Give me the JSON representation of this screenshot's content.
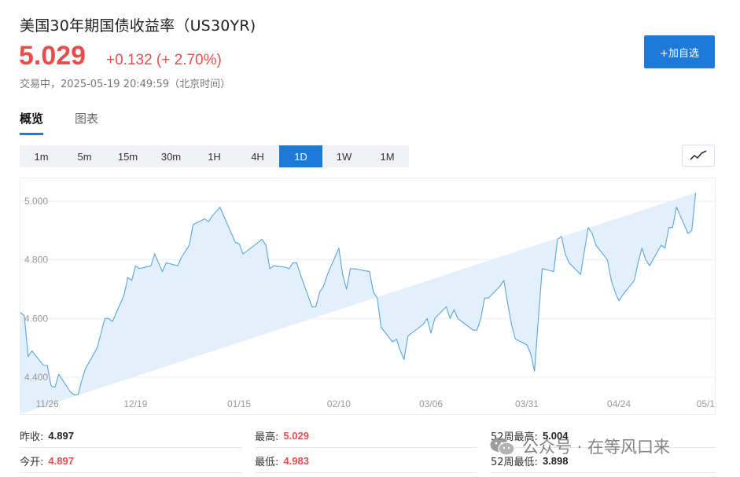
{
  "header": {
    "title": "美国30年期国债收益率（US30YR)",
    "price": "5.029",
    "change": "+0.132 (+ 2.70%)",
    "status": "交易中，2025-05-19 20:49:59（北京时间）",
    "fav_button": "+加自选"
  },
  "tabs": [
    {
      "label": "概览",
      "active": true
    },
    {
      "label": "图表",
      "active": false
    }
  ],
  "periods": [
    {
      "label": "1m",
      "active": false
    },
    {
      "label": "5m",
      "active": false
    },
    {
      "label": "15m",
      "active": false
    },
    {
      "label": "30m",
      "active": false
    },
    {
      "label": "1H",
      "active": false
    },
    {
      "label": "4H",
      "active": false
    },
    {
      "label": "1D",
      "active": true
    },
    {
      "label": "1W",
      "active": false
    },
    {
      "label": "1M",
      "active": false
    }
  ],
  "chart_type_icon": "line-chart-icon",
  "chart_data": {
    "type": "area",
    "x": [
      "2024-11-19",
      "2024-11-20",
      "2024-11-21",
      "2024-11-22",
      "2024-11-25",
      "2024-11-26",
      "2024-11-27",
      "2024-11-28",
      "2024-11-29",
      "2024-12-02",
      "2024-12-03",
      "2024-12-04",
      "2024-12-05",
      "2024-12-06",
      "2024-12-09",
      "2024-12-10",
      "2024-12-11",
      "2024-12-12",
      "2024-12-13",
      "2024-12-16",
      "2024-12-17",
      "2024-12-18",
      "2024-12-19",
      "2024-12-20",
      "2024-12-23",
      "2024-12-24",
      "2024-12-26",
      "2024-12-27",
      "2024-12-30",
      "2024-12-31",
      "2025-01-02",
      "2025-01-03",
      "2025-01-06",
      "2025-01-07",
      "2025-01-08",
      "2025-01-09",
      "2025-01-10",
      "2025-01-13",
      "2025-01-14",
      "2025-01-15",
      "2025-01-16",
      "2025-01-17",
      "2025-01-21",
      "2025-01-22",
      "2025-01-23",
      "2025-01-24",
      "2025-01-27",
      "2025-01-28",
      "2025-01-29",
      "2025-01-30",
      "2025-01-31",
      "2025-02-03",
      "2025-02-04",
      "2025-02-05",
      "2025-02-06",
      "2025-02-07",
      "2025-02-10",
      "2025-02-11",
      "2025-02-12",
      "2025-02-13",
      "2025-02-14",
      "2025-02-18",
      "2025-02-19",
      "2025-02-20",
      "2025-02-21",
      "2025-02-24",
      "2025-02-25",
      "2025-02-26",
      "2025-02-27",
      "2025-02-28",
      "2025-03-03",
      "2025-03-04",
      "2025-03-05",
      "2025-03-06",
      "2025-03-07",
      "2025-03-10",
      "2025-03-11",
      "2025-03-12",
      "2025-03-13",
      "2025-03-14",
      "2025-03-17",
      "2025-03-18",
      "2025-03-19",
      "2025-03-20",
      "2025-03-21",
      "2025-03-24",
      "2025-03-25",
      "2025-03-26",
      "2025-03-27",
      "2025-03-28",
      "2025-03-31",
      "2025-04-01",
      "2025-04-02",
      "2025-04-03",
      "2025-04-04",
      "2025-04-07",
      "2025-04-08",
      "2025-04-09",
      "2025-04-10",
      "2025-04-11",
      "2025-04-14",
      "2025-04-15",
      "2025-04-16",
      "2025-04-17",
      "2025-04-18",
      "2025-04-21",
      "2025-04-22",
      "2025-04-23",
      "2025-04-24",
      "2025-04-25",
      "2025-04-28",
      "2025-04-29",
      "2025-04-30",
      "2025-05-01",
      "2025-05-02",
      "2025-05-05",
      "2025-05-06",
      "2025-05-07",
      "2025-05-08",
      "2025-05-09",
      "2025-05-12",
      "2025-05-13",
      "2025-05-14",
      "2025-05-15",
      "2025-05-16",
      "2025-05-19"
    ],
    "y": [
      4.62,
      4.61,
      4.47,
      4.49,
      4.44,
      4.44,
      4.37,
      4.365,
      4.41,
      4.35,
      4.34,
      4.34,
      4.39,
      4.43,
      4.5,
      4.55,
      4.6,
      4.6,
      4.59,
      4.68,
      4.74,
      4.73,
      4.78,
      4.77,
      4.78,
      4.82,
      4.76,
      4.79,
      4.78,
      4.81,
      4.85,
      4.92,
      4.94,
      4.93,
      4.95,
      4.965,
      4.98,
      4.89,
      4.86,
      4.855,
      4.82,
      4.83,
      4.87,
      4.85,
      4.77,
      4.78,
      4.775,
      4.77,
      4.79,
      4.79,
      4.75,
      4.64,
      4.64,
      4.69,
      4.71,
      4.75,
      4.84,
      4.75,
      4.7,
      4.77,
      4.77,
      4.76,
      4.69,
      4.67,
      4.57,
      4.52,
      4.53,
      4.49,
      4.46,
      4.54,
      4.57,
      4.58,
      4.6,
      4.55,
      4.6,
      4.64,
      4.6,
      4.63,
      4.6,
      4.59,
      4.56,
      4.56,
      4.6,
      4.67,
      4.67,
      4.71,
      4.73,
      4.65,
      4.58,
      4.53,
      4.51,
      4.48,
      4.42,
      4.6,
      4.77,
      4.76,
      4.87,
      4.88,
      4.82,
      4.79,
      4.75,
      4.83,
      4.91,
      4.89,
      4.85,
      4.8,
      4.73,
      4.69,
      4.66,
      4.68,
      4.73,
      4.79,
      4.84,
      4.8,
      4.78,
      4.85,
      4.84,
      4.91,
      4.91,
      4.98,
      4.89,
      4.9,
      5.029
    ],
    "yticks": [
      "4.400",
      "4.600",
      "4.800",
      "5.000"
    ],
    "xticks": [
      {
        "date": "2024-11-26",
        "label": "11/26"
      },
      {
        "date": "2024-12-19",
        "label": "12/19"
      },
      {
        "date": "2025-01-15",
        "label": "01/15"
      },
      {
        "date": "2025-02-10",
        "label": "02/10"
      },
      {
        "date": "2025-03-06",
        "label": "03/06"
      },
      {
        "date": "2025-03-31",
        "label": "03/31"
      },
      {
        "date": "2025-04-24",
        "label": "04/24"
      },
      {
        "date": "2025-05-19",
        "label": "05/1"
      }
    ],
    "ylim": [
      4.33,
      5.07
    ],
    "grid": true,
    "line_color": "#5aa5dc",
    "fill_color": "#e3f0fc"
  },
  "stats": [
    [
      {
        "label": "昨收:",
        "value": "4.897",
        "color": "dark"
      },
      {
        "label": "最高:",
        "value": "5.029",
        "color": "red"
      },
      {
        "label": "52周最高:",
        "value": "5.004",
        "color": "dark"
      }
    ],
    [
      {
        "label": "今开:",
        "value": "4.897",
        "color": "red"
      },
      {
        "label": "最低:",
        "value": "4.983",
        "color": "red"
      },
      {
        "label": "52周最低:",
        "value": "3.898",
        "color": "dark"
      }
    ]
  ],
  "watermark": {
    "text": "公众号 · 在等风口来",
    "icon": "wechat-icon"
  }
}
